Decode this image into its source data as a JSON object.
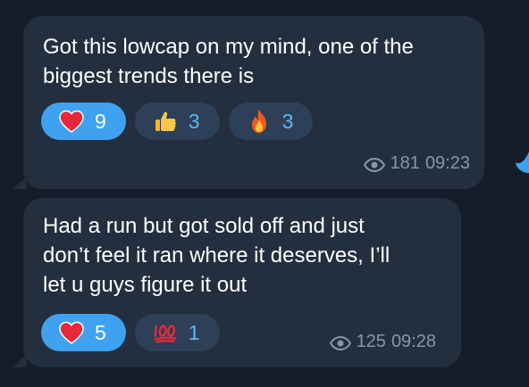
{
  "messages": [
    {
      "text": "Got this lowcap on my mind, one of the\nbiggest trends there is",
      "reactions": [
        {
          "emoji": "heart-icon",
          "count": "9",
          "active": true
        },
        {
          "emoji": "thumbs-up-icon",
          "count": "3",
          "active": false
        },
        {
          "emoji": "fire-icon",
          "count": "3",
          "active": false
        }
      ],
      "views": "181",
      "time": "09:23"
    },
    {
      "text": "Had a run but got sold off and just\ndon’t feel it ran where it deserves, I’ll\nlet u guys figure it out",
      "reactions": [
        {
          "emoji": "heart-icon",
          "count": "5",
          "active": true
        },
        {
          "emoji": "hundred-icon",
          "count": "1",
          "active": false
        }
      ],
      "views": "125",
      "time": "09:28"
    }
  ],
  "colors": {
    "background": "#151d28",
    "bubble": "#232f3e",
    "accent": "#3ea2f0",
    "reaction_inactive": "#2d4057",
    "meta_text": "#8597ab"
  }
}
